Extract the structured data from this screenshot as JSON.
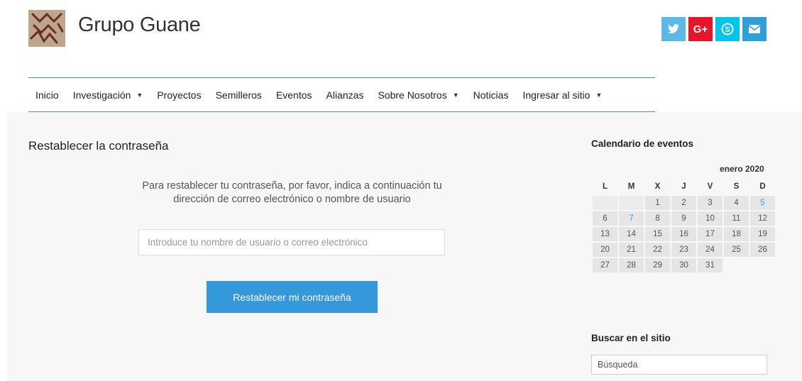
{
  "site": {
    "title": "Grupo Guane"
  },
  "social": [
    {
      "name": "twitter",
      "glyph": "🐦",
      "color": "#5cb8e8"
    },
    {
      "name": "google-plus",
      "glyph": "G+",
      "color": "#e8152a"
    },
    {
      "name": "skype",
      "glyph": "S",
      "color": "#00c4ea"
    },
    {
      "name": "email",
      "glyph": "✉",
      "color": "#2f9fd8"
    }
  ],
  "nav": [
    {
      "label": "Inicio",
      "dropdown": false
    },
    {
      "label": "Investigación",
      "dropdown": true
    },
    {
      "label": "Proyectos",
      "dropdown": false
    },
    {
      "label": "Semilleros",
      "dropdown": false
    },
    {
      "label": "Eventos",
      "dropdown": false
    },
    {
      "label": "Alianzas",
      "dropdown": false
    },
    {
      "label": "Sobre Nosotros",
      "dropdown": true
    },
    {
      "label": "Noticias",
      "dropdown": false
    },
    {
      "label": "Ingresar al sitio",
      "dropdown": true
    }
  ],
  "main": {
    "title": "Restablecer la contraseña",
    "instructions": "Para restablecer tu contraseña, por favor, indica a continuación tu dirección de correo electrónico o nombre de usuario",
    "input_placeholder": "Introduce tu nombre de usuario o correo electrónico",
    "button_label": "Restablecer mi contraseña"
  },
  "calendar": {
    "heading": "Calendario de eventos",
    "month": "enero 2020",
    "weekdays": [
      "L",
      "M",
      "X",
      "J",
      "V",
      "S",
      "D"
    ],
    "weeks": [
      [
        "",
        "",
        "1",
        "2",
        "3",
        "4",
        "5"
      ],
      [
        "6",
        "7",
        "8",
        "9",
        "10",
        "11",
        "12"
      ],
      [
        "13",
        "14",
        "15",
        "16",
        "17",
        "18",
        "19"
      ],
      [
        "20",
        "21",
        "22",
        "23",
        "24",
        "25",
        "26"
      ],
      [
        "27",
        "28",
        "29",
        "30",
        "31",
        "",
        ""
      ]
    ],
    "linked_days": [
      "5",
      "7"
    ]
  },
  "search": {
    "heading": "Buscar en el sitio",
    "placeholder": "Búsqueda"
  }
}
